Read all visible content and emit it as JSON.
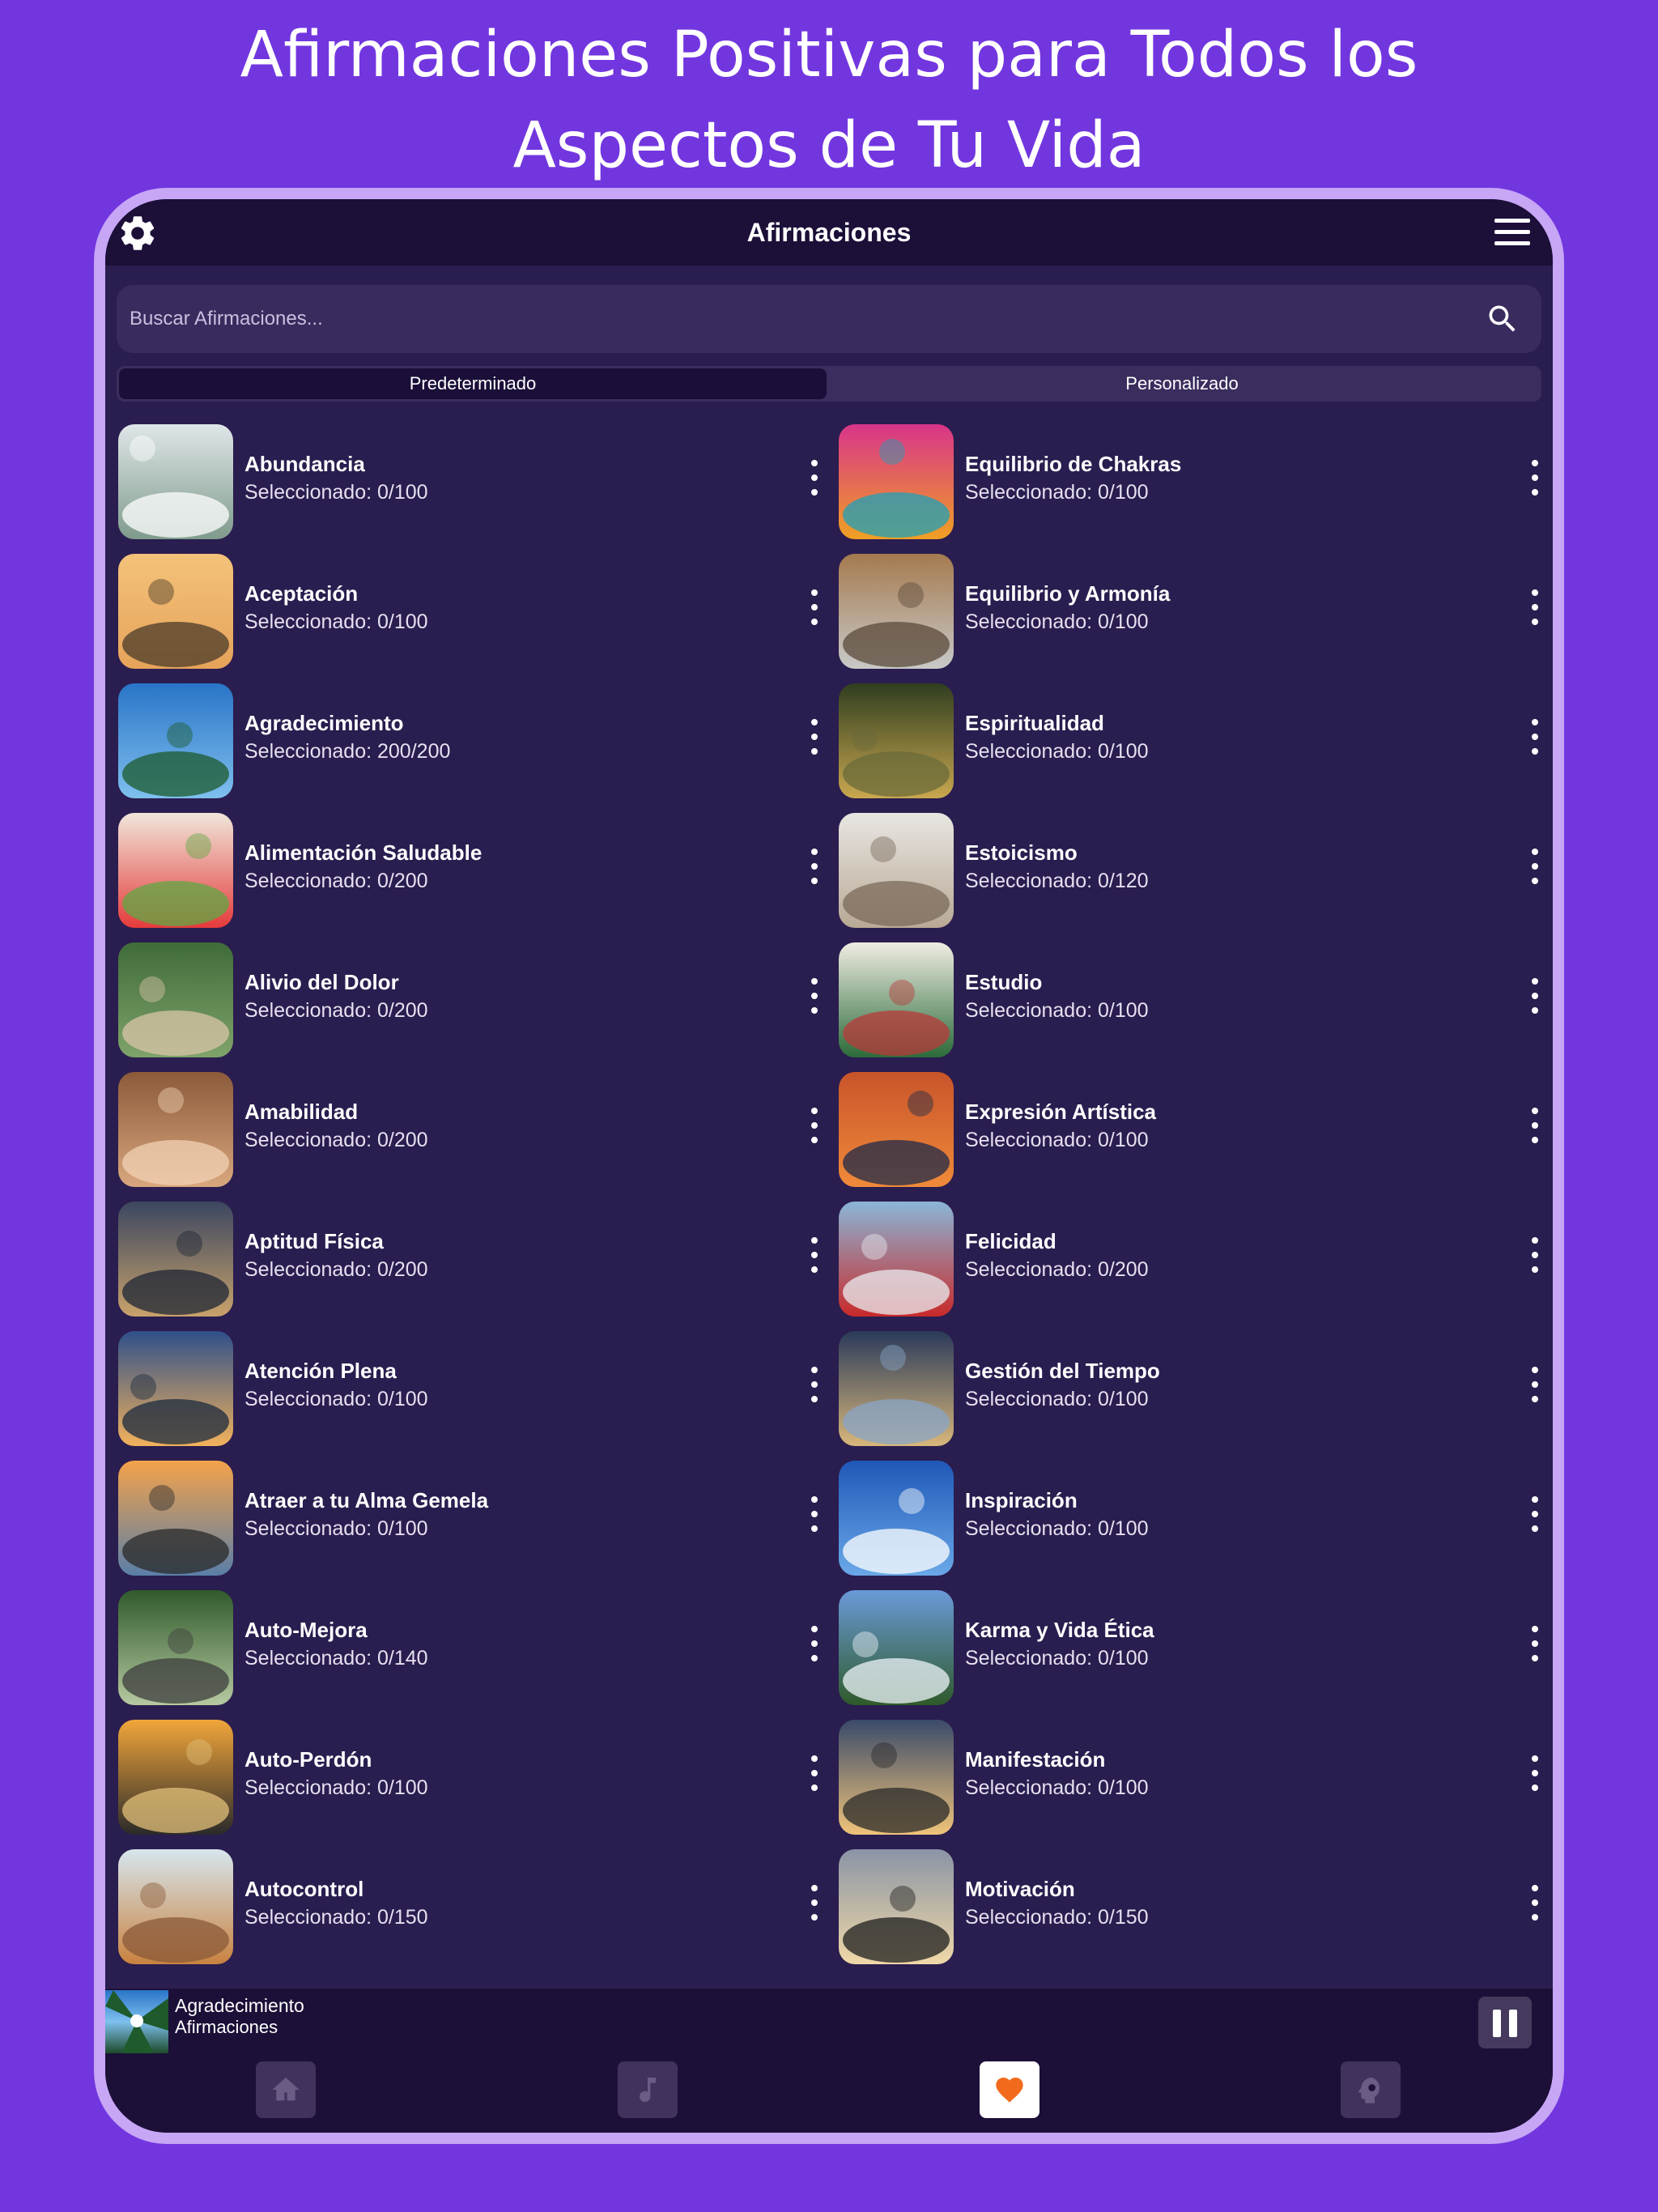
{
  "headline": {
    "line1": "Afirmaciones Positivas para Todos los",
    "line2": "Aspectos de Tu Vida"
  },
  "app": {
    "title": "Afirmaciones",
    "search_placeholder": "Buscar Afirmaciones...",
    "tabs": [
      {
        "label": "Predeterminado",
        "active": true
      },
      {
        "label": "Personalizado",
        "active": false
      }
    ]
  },
  "left_items": [
    {
      "name": "Abundancia",
      "selected": "Seleccionado: 0/100"
    },
    {
      "name": "Aceptación",
      "selected": "Seleccionado: 0/100"
    },
    {
      "name": "Agradecimiento",
      "selected": "Seleccionado: 200/200"
    },
    {
      "name": "Alimentación Saludable",
      "selected": "Seleccionado: 0/200"
    },
    {
      "name": "Alivio del Dolor",
      "selected": "Seleccionado: 0/200"
    },
    {
      "name": "Amabilidad",
      "selected": "Seleccionado: 0/200"
    },
    {
      "name": "Aptitud Física",
      "selected": "Seleccionado: 0/200"
    },
    {
      "name": "Atención Plena",
      "selected": "Seleccionado: 0/100"
    },
    {
      "name": "Atraer a tu Alma Gemela",
      "selected": "Seleccionado: 0/100"
    },
    {
      "name": "Auto-Mejora",
      "selected": "Seleccionado: 0/140"
    },
    {
      "name": "Auto-Perdón",
      "selected": "Seleccionado: 0/100"
    },
    {
      "name": "Autocontrol",
      "selected": "Seleccionado: 0/150"
    }
  ],
  "right_items": [
    {
      "name": "Equilibrio de Chakras",
      "selected": "Seleccionado: 0/100"
    },
    {
      "name": "Equilibrio y Armonía",
      "selected": "Seleccionado: 0/100"
    },
    {
      "name": "Espiritualidad",
      "selected": "Seleccionado: 0/100"
    },
    {
      "name": "Estoicismo",
      "selected": "Seleccionado: 0/120"
    },
    {
      "name": "Estudio",
      "selected": "Seleccionado: 0/100"
    },
    {
      "name": "Expresión Artística",
      "selected": "Seleccionado: 0/100"
    },
    {
      "name": "Felicidad",
      "selected": "Seleccionado: 0/200"
    },
    {
      "name": "Gestión del Tiempo",
      "selected": "Seleccionado: 0/100"
    },
    {
      "name": "Inspiración",
      "selected": "Seleccionado: 0/100"
    },
    {
      "name": "Karma y Vida Ética",
      "selected": "Seleccionado: 0/100"
    },
    {
      "name": "Manifestación",
      "selected": "Seleccionado: 0/100"
    },
    {
      "name": "Motivación",
      "selected": "Seleccionado: 0/150"
    }
  ],
  "now_playing": {
    "title": "Agradecimiento",
    "subtitle": "Afirmaciones"
  },
  "bottom_nav": [
    {
      "icon": "home-icon",
      "active": false
    },
    {
      "icon": "music-note-icon",
      "active": false
    },
    {
      "icon": "heart-icon",
      "active": true
    },
    {
      "icon": "mind-gear-icon",
      "active": false
    }
  ],
  "colors": {
    "background": "#7236df",
    "frame": "#c6a6f5",
    "screen": "#2a1d4f",
    "bar": "#1c0f38",
    "accent_heart": "#f26b1d"
  }
}
